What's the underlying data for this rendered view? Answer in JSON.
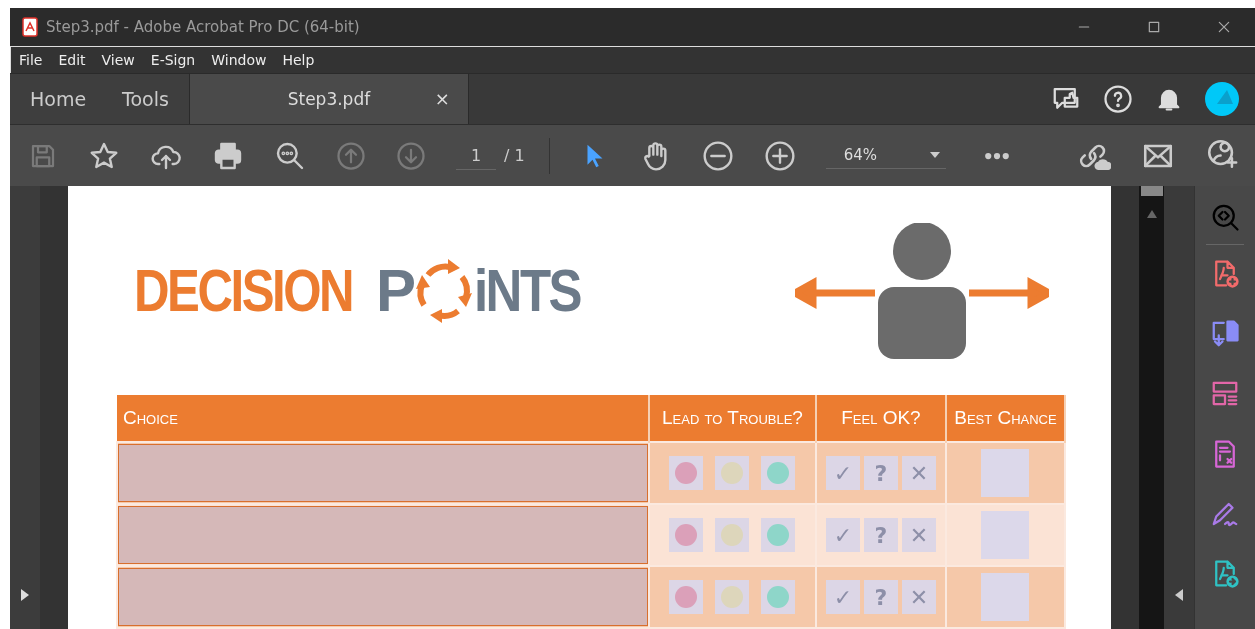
{
  "window": {
    "title": "Step3.pdf - Adobe Acrobat Pro DC (64-bit)"
  },
  "menu": [
    "File",
    "Edit",
    "View",
    "E-Sign",
    "Window",
    "Help"
  ],
  "tabs": [
    {
      "kind": "nav",
      "label": "Home",
      "selected": false
    },
    {
      "kind": "nav",
      "label": "Tools",
      "selected": false
    },
    {
      "kind": "document",
      "label": "Step3.pdf",
      "selected": true,
      "close": "×"
    }
  ],
  "toolbar": {
    "save_disabled": true,
    "prev_page_disabled": true,
    "next_page_disabled": true,
    "select_tool_active": true,
    "page": "1",
    "page_total": "/ 1",
    "zoom": "64%"
  },
  "document": {
    "logo": {
      "word": "DECISION",
      "second_start": "P",
      "second_end": "iNTS"
    },
    "table": {
      "columns": [
        "Choice",
        "Lead to Trouble?",
        "Feel OK?",
        "Best Chance"
      ],
      "rows": [
        {
          "trouble_dots": [
            {
              "color": "#dba0b9"
            },
            {
              "color": "#ddd6bb"
            },
            {
              "color": "#8ed6c9"
            }
          ],
          "feel": [
            "✓",
            "?",
            "✕"
          ],
          "best_chance_checked": false
        },
        {
          "trouble_dots": [
            {
              "color": "#dba0b9"
            },
            {
              "color": "#ddd6bb"
            },
            {
              "color": "#8ed6c9"
            }
          ],
          "feel": [
            "✓",
            "?",
            "✕"
          ],
          "best_chance_checked": false
        },
        {
          "trouble_dots": [
            {
              "color": "#dba0b9"
            },
            {
              "color": "#ddd6bb"
            },
            {
              "color": "#8ed6c9"
            }
          ],
          "feel": [
            "✓",
            "?",
            "✕"
          ],
          "best_chance_checked": false
        }
      ]
    }
  }
}
